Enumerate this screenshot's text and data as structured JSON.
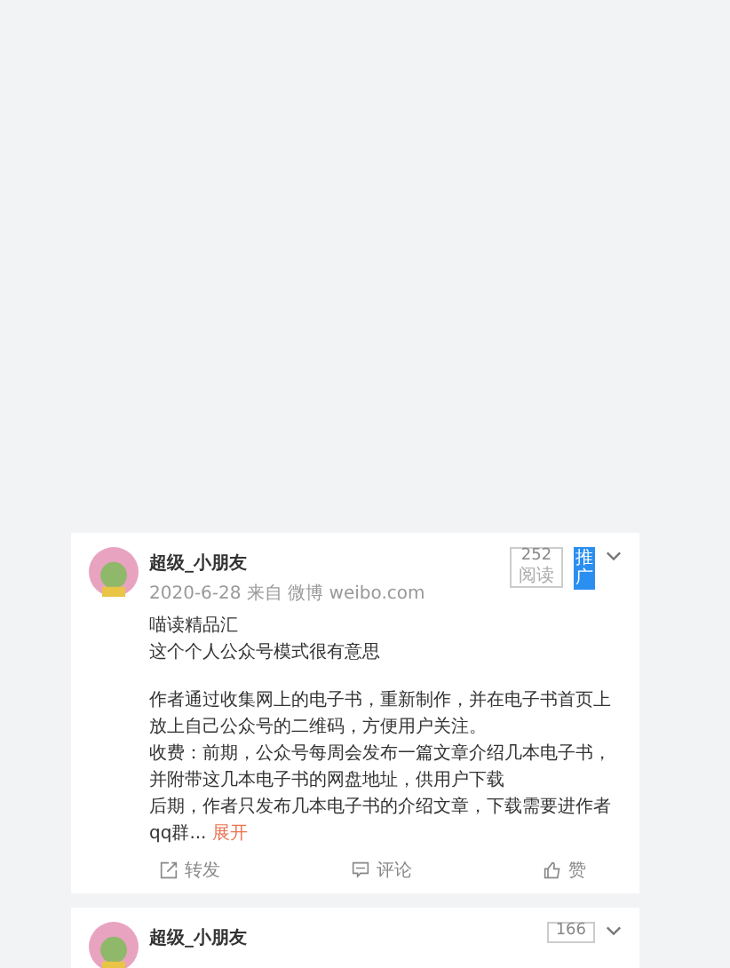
{
  "posts": [
    {
      "author": "超级_小朋友",
      "meta": "2020-6-28 来自 微博 weibo.com",
      "read_count": "252",
      "read_label": "阅读",
      "promo_label": "推广",
      "paragraphs": [
        "喵读精品汇",
        "这个个人公众号模式很有意思",
        "作者通过收集网上的电子书，重新制作，并在电子书首页上放上自己公众号的二维码，方便用户关注。",
        "收费：前期，公众号每周会发布一篇文章介绍几本电子书，并附带这几本电子书的网盘地址，供用户下载",
        "后期，作者只发布几本电子书的介绍文章，下载需要进作者qq群"
      ],
      "ellipsis": "...",
      "expand_label": "展开",
      "actions": [
        {
          "kind": "repost",
          "label": "转发"
        },
        {
          "kind": "comment",
          "label": "评论"
        },
        {
          "kind": "like",
          "label": "赞"
        }
      ]
    },
    {
      "author": "超级_小朋友",
      "read_count": "166"
    }
  ]
}
